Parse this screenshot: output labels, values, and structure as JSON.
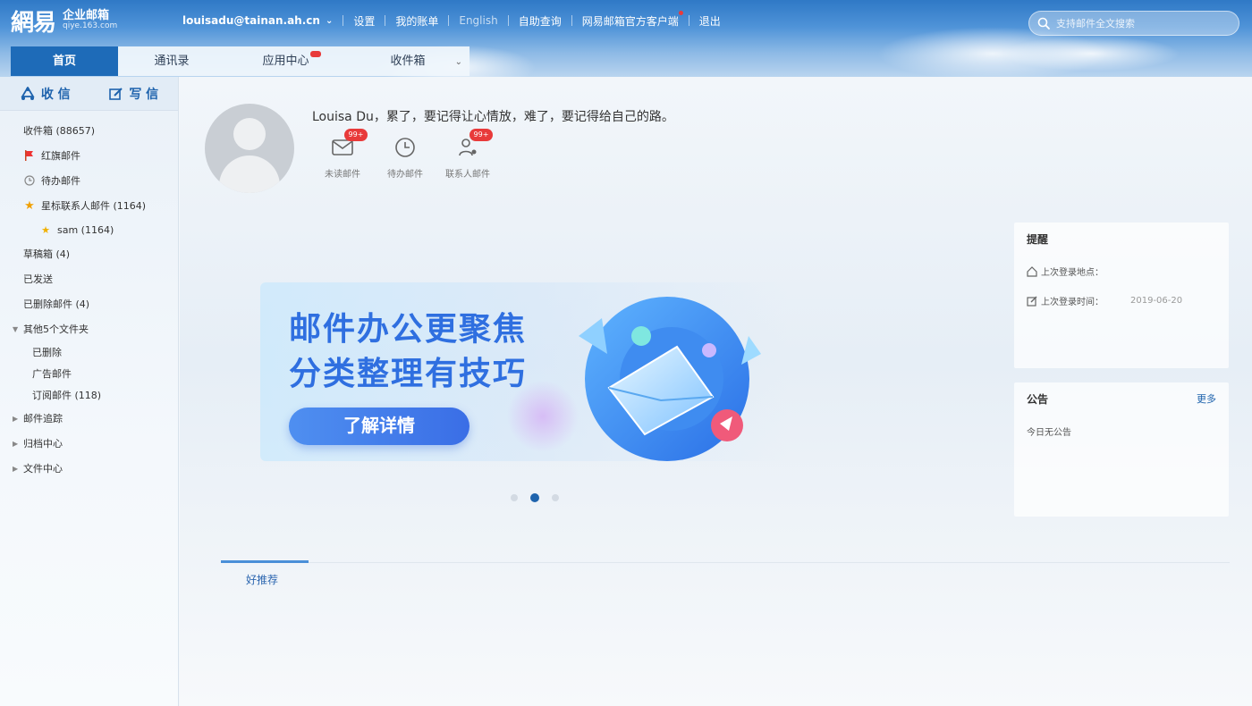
{
  "app": {
    "logo_mark": "網易",
    "logo_title": "企业邮箱",
    "logo_sub": "qiye.163.com"
  },
  "topnav": {
    "user": "louisadu@tainan.ah.cn",
    "links": [
      "设置",
      "我的账单",
      "English",
      "自助查询",
      "网易邮箱官方客户端",
      "退出"
    ]
  },
  "search": {
    "placeholder": "支持邮件全文搜索"
  },
  "tabs": [
    "首页",
    "通讯录",
    "应用中心",
    "收件箱"
  ],
  "sidebar": {
    "receive": "收 信",
    "write": "写 信",
    "folders": {
      "inbox": "收件箱 (88657)",
      "flagged": "红旗邮件",
      "todo": "待办邮件",
      "starred": "星标联系人邮件 (1164)",
      "starred_contact": "sam (1164)",
      "drafts": "草稿箱 (4)",
      "sent": "已发送",
      "deleted": "已删除邮件 (4)",
      "other": "其他5个文件夹",
      "trash": "已删除",
      "ads": "广告邮件",
      "subscribed": "订阅邮件 (118)",
      "tracking": "邮件追踪",
      "archive": "归档中心",
      "files": "文件中心"
    }
  },
  "profile": {
    "greeting": "Louisa Du，累了，要记得让心情放，难了，要记得给自己的路。",
    "quick": [
      {
        "label": "未读邮件",
        "badge": "99+"
      },
      {
        "label": "待办邮件",
        "badge": ""
      },
      {
        "label": "联系人邮件",
        "badge": "99+"
      }
    ]
  },
  "banner": {
    "line1": "邮件办公更聚焦",
    "line2": "分类整理有技巧",
    "button": "了解详情",
    "active_slide": 2,
    "slide_count": 3
  },
  "reminder": {
    "title": "提醒",
    "login_location": "上次登录地点：",
    "last_login": "上次登录时间：",
    "last_login_value": "2019-06-20"
  },
  "notice": {
    "title": "公告",
    "more": "更多",
    "empty": "今日无公告"
  },
  "recommend": {
    "tab": "好推荐"
  },
  "colors": {
    "accent": "#1e6bb8",
    "header_top": "#2f79c6",
    "badge_red": "#e83a3a",
    "banner_text": "#2f6fe0"
  }
}
